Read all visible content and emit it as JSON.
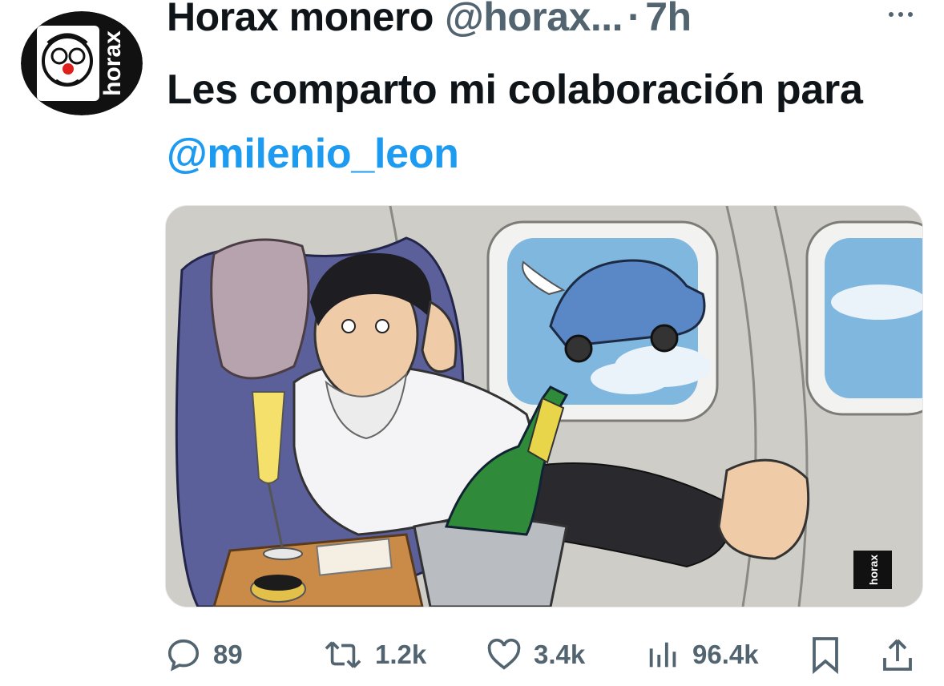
{
  "author": {
    "name": "Horax monero",
    "handle": "@horax...",
    "separator": "·",
    "time": "7h",
    "avatar_text": "horax"
  },
  "tweet": {
    "text_part1": "Les comparto mi colaboración para ",
    "mention": "@milenio_leon"
  },
  "media": {
    "signature_text": "horax",
    "icons": [
      "champagne-glass",
      "champagne-bottle",
      "flying-car",
      "airplane-window"
    ]
  },
  "actions": {
    "reply_count": "89",
    "retweet_count": "1.2k",
    "like_count": "3.4k",
    "views_count": "96.4k"
  },
  "colors": {
    "accent": "#1d9bf0",
    "secondary_text": "#536471",
    "primary_text": "#0f1419"
  }
}
